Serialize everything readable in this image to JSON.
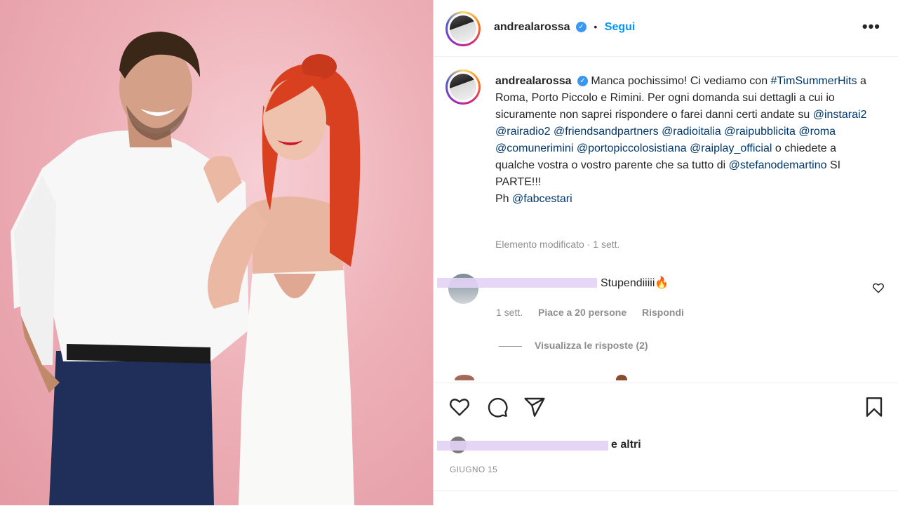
{
  "post": {
    "username": "andrealarossa",
    "follow_label": "Segui",
    "more_label": "•••"
  },
  "caption": {
    "username": "andrealarossa",
    "parts": [
      {
        "text": "Manca pochissimo! Ci vediamo con ",
        "type": "text"
      },
      {
        "text": "#TimSummerHits",
        "type": "tag"
      },
      {
        "text": " a Roma, Porto Piccolo e Rimini. Per ogni domanda sui dettagli a cui io sicuramente non saprei rispondere o farei danni certi andate su ",
        "type": "text"
      },
      {
        "text": "@instarai2",
        "type": "tag"
      },
      {
        "text": " ",
        "type": "text"
      },
      {
        "text": "@rairadio2",
        "type": "tag"
      },
      {
        "text": " ",
        "type": "text"
      },
      {
        "text": "@friendsandpartners",
        "type": "tag"
      },
      {
        "text": " ",
        "type": "text"
      },
      {
        "text": "@radioitalia",
        "type": "tag"
      },
      {
        "text": " ",
        "type": "text"
      },
      {
        "text": "@raipubblicita",
        "type": "tag"
      },
      {
        "text": " ",
        "type": "text"
      },
      {
        "text": "@roma",
        "type": "tag"
      },
      {
        "text": " ",
        "type": "text"
      },
      {
        "text": "@comunerimini",
        "type": "tag"
      },
      {
        "text": " ",
        "type": "text"
      },
      {
        "text": "@portopiccolosistiana",
        "type": "tag"
      },
      {
        "text": " ",
        "type": "text"
      },
      {
        "text": "@raiplay_official",
        "type": "tag"
      },
      {
        "text": " o chiedete a qualche vostra o vostro parente che sa tutto di ",
        "type": "text"
      },
      {
        "text": "@stefanodemartino",
        "type": "tag"
      },
      {
        "text": " SI PARTE!!!",
        "type": "text"
      }
    ],
    "ph_prefix": "Ph ",
    "ph_tag": "@fabcestari",
    "meta": "Elemento modificato · 1 sett."
  },
  "comment": {
    "text": "Stupendiiiii🔥",
    "time": "1 sett.",
    "likes": "Piace a 20 persone",
    "reply": "Rispondi",
    "view_replies": "Visualizza le risposte (2)"
  },
  "likes": {
    "suffix": "e altri"
  },
  "date": "GIUGNO 15",
  "colors": {
    "link": "#00376b",
    "follow": "#0095f6",
    "muted": "#8e8e8e",
    "verified": "#3897f0"
  },
  "icons": [
    "verified-icon",
    "more-options-icon",
    "heart-icon",
    "comment-icon",
    "share-icon",
    "save-icon"
  ]
}
